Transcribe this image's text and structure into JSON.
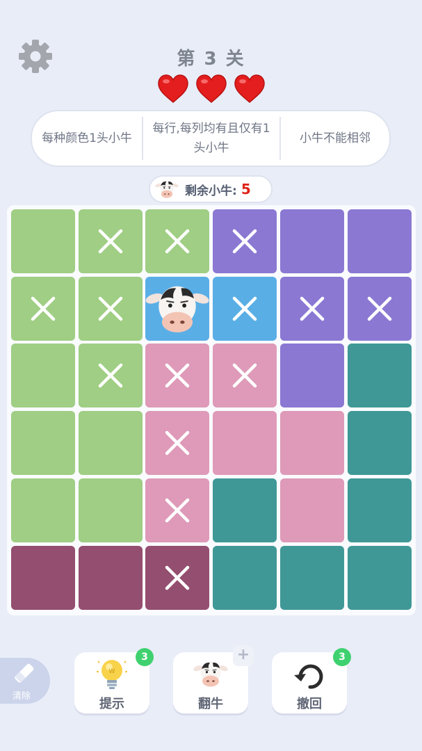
{
  "header": {
    "settings_icon": "gear-icon",
    "level_title": "第 3 关",
    "lives": 3,
    "heart_color": "#e41e1e"
  },
  "rules": [
    "每种颜色1头小牛",
    "每行,每列均有且仅有1头小牛",
    "小牛不能相邻"
  ],
  "remaining": {
    "label": "剩余小牛:",
    "count": "5",
    "icon": "cow-face-icon"
  },
  "board": {
    "size": 6,
    "colors": {
      "G": "#9fce84",
      "P": "#8b78d3",
      "B": "#5aaee6",
      "K": "#de9ab8",
      "T": "#3f9896",
      "M": "#944e6f"
    },
    "rows": [
      [
        "G",
        "G",
        "G",
        "P",
        "P",
        "P"
      ],
      [
        "G",
        "G",
        "B",
        "B",
        "P",
        "P"
      ],
      [
        "G",
        "G",
        "K",
        "K",
        "P",
        "T"
      ],
      [
        "G",
        "G",
        "K",
        "K",
        "K",
        "T"
      ],
      [
        "G",
        "G",
        "K",
        "T",
        "K",
        "T"
      ],
      [
        "M",
        "M",
        "M",
        "T",
        "T",
        "T"
      ]
    ],
    "marks": [
      [
        "",
        "x",
        "x",
        "x",
        "",
        ""
      ],
      [
        "x",
        "x",
        "cow",
        "x",
        "x",
        "x"
      ],
      [
        "",
        "x",
        "x",
        "x",
        "",
        ""
      ],
      [
        "",
        "",
        "x",
        "",
        "",
        ""
      ],
      [
        "",
        "",
        "x",
        "",
        "",
        ""
      ],
      [
        "",
        "",
        "x",
        "",
        "",
        ""
      ]
    ]
  },
  "toolbar": {
    "eraser": {
      "label": "清除",
      "icon": "eraser-icon"
    },
    "hint": {
      "label": "提示",
      "badge": "3",
      "icon": "lightbulb-icon"
    },
    "flip": {
      "label": "翻牛",
      "badge": "+",
      "icon": "cow-face-icon"
    },
    "undo": {
      "label": "撤回",
      "badge": "3",
      "icon": "undo-icon"
    }
  }
}
